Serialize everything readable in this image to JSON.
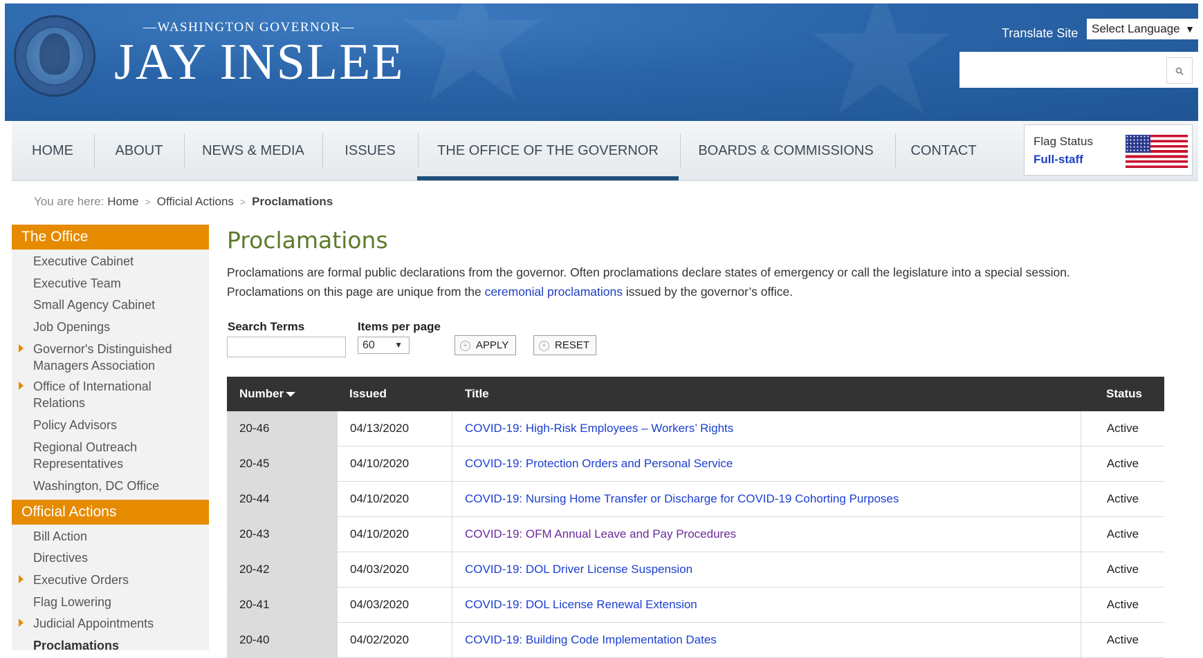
{
  "header": {
    "sup_title": "—WASHINGTON GOVERNOR—",
    "main_title": "JAY INSLEE",
    "translate_label": "Translate Site",
    "language_select": "Select Language",
    "search_placeholder": ""
  },
  "nav": {
    "items": [
      "HOME",
      "ABOUT",
      "NEWS & MEDIA",
      "ISSUES",
      "THE OFFICE OF THE GOVERNOR",
      "BOARDS & COMMISSIONS",
      "CONTACT"
    ],
    "active_index": 4,
    "flag_label": "Flag Status",
    "flag_value": "Full-staff"
  },
  "breadcrumb": {
    "prefix": "You are here:",
    "items": [
      "Home",
      "Official Actions",
      "Proclamations"
    ]
  },
  "sidebar": {
    "section1": "The Office",
    "office_items": [
      "Executive Cabinet",
      "Executive Team",
      "Small Agency Cabinet",
      "Job Openings",
      "Governor's Distinguished",
      "Managers Association",
      "Office of International",
      "Relations",
      "Policy Advisors",
      "Regional Outreach",
      "Representatives",
      "Washington, DC Office"
    ],
    "section2": "Official Actions",
    "actions_items": [
      "Bill Action",
      "Directives",
      "Executive Orders",
      "Flag Lowering",
      "Judicial Appointments",
      "Proclamations"
    ]
  },
  "main": {
    "title": "Proclamations",
    "intro_1": "Proclamations are formal public declarations from the governor. Often proclamations declare states of emergency or call the legislature into a special session.",
    "intro_2a": "Proclamations on this page are unique from the ",
    "intro_link": "ceremonial proclamations",
    "intro_2b": " issued by the governor’s office.",
    "search_label": "Search Terms",
    "search_value": "",
    "per_page_label": "Items per page",
    "per_page_value": "60",
    "apply_label": "APPLY",
    "reset_label": "RESET"
  },
  "table": {
    "headers": [
      "Number",
      "Issued",
      "Title",
      "Status"
    ],
    "rows": [
      {
        "number": "20-46",
        "issued": "04/13/2020",
        "title": "COVID-19: High-Risk Employees – Workers’ Rights",
        "status": "Active"
      },
      {
        "number": "20-45",
        "issued": "04/10/2020",
        "title": "COVID-19: Protection Orders and Personal Service",
        "status": "Active"
      },
      {
        "number": "20-44",
        "issued": "04/10/2020",
        "title": "COVID-19: Nursing Home Transfer or Discharge for COVID-19 Cohorting Purposes",
        "status": "Active"
      },
      {
        "number": "20-43",
        "issued": "04/10/2020",
        "title": "COVID-19: OFM Annual Leave and Pay Procedures",
        "status": "Active"
      },
      {
        "number": "20-42",
        "issued": "04/03/2020",
        "title": "COVID-19: DOL Driver License Suspension",
        "status": "Active"
      },
      {
        "number": "20-41",
        "issued": "04/03/2020",
        "title": "COVID-19: DOL License Renewal Extension",
        "status": "Active"
      },
      {
        "number": "20-40",
        "issued": "04/02/2020",
        "title": "COVID-19: Building Code Implementation Dates",
        "status": "Active"
      }
    ]
  },
  "colors": {
    "header_blue": "#2a64a8",
    "sidebar_orange": "#e68a00",
    "title_green": "#5d7a2a",
    "link_blue": "#1a3fd0",
    "visited_purple": "#6a2a9a",
    "table_header": "#333333"
  },
  "icons": {
    "search": "search-icon",
    "flag": "us-flag-icon",
    "sort": "sort-desc-icon",
    "sidebar_arrow": "chevron-right-icon"
  }
}
